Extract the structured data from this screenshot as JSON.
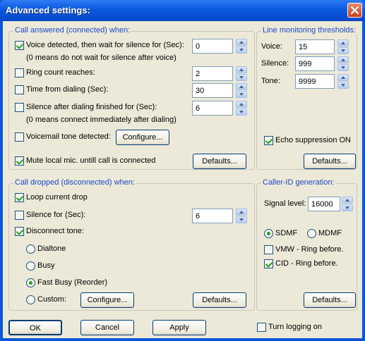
{
  "window": {
    "title": "Advanced settings:"
  },
  "answered": {
    "legend": "Call answered (connected) when:",
    "voice_label": "Voice detected, then wait for silence for (Sec):",
    "voice_value": "0",
    "voice_note": "(0 means do not wait for silence after voice)",
    "ring_label": "Ring count reaches:",
    "ring_value": "2",
    "time_label": "Time from dialing (Sec):",
    "time_value": "30",
    "silence_label": "Silence after dialing finished for (Sec):",
    "silence_value": "6",
    "silence_note": "(0 means connect immediately after dialing)",
    "voicemail_label": "Voicemail tone detected:",
    "configure_label": "Configure...",
    "mute_label": "Mute local mic. untill call is connected",
    "defaults_label": "Defaults..."
  },
  "monitoring": {
    "legend": "Line monitoring thresholds:",
    "voice_label": "Voice:",
    "voice_value": "15",
    "silence_label": "Silence:",
    "silence_value": "999",
    "tone_label": "Tone:",
    "tone_value": "9999",
    "echo_label": "Echo suppression ON",
    "defaults_label": "Defaults..."
  },
  "dropped": {
    "legend": "Call dropped (disconnected) when:",
    "loop_label": "Loop current drop",
    "silence_label": "Silence for (Sec):",
    "silence_value": "6",
    "disconnect_label": "Disconnect tone:",
    "dialtone_label": "Dialtone",
    "busy_label": "Busy",
    "fastbusy_label": "Fast Busy (Reorder)",
    "custom_label": "Custom:",
    "configure_label": "Configure...",
    "defaults_label": "Defaults..."
  },
  "callerid": {
    "legend": "Caller-ID generation:",
    "signal_label": "Signal level:",
    "signal_value": "16000",
    "sdmf_label": "SDMF",
    "mdmf_label": "MDMF",
    "vmw_label": "VMW - Ring before.",
    "cid_label": "CID - Ring before.",
    "defaults_label": "Defaults..."
  },
  "footer": {
    "ok_label": "OK",
    "cancel_label": "Cancel",
    "apply_label": "Apply",
    "logging_label": "Turn logging on"
  }
}
